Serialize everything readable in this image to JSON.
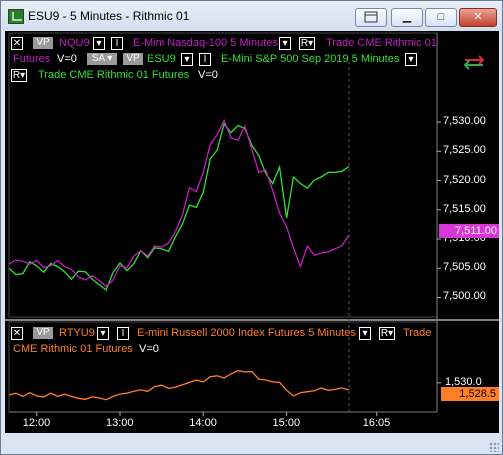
{
  "window": {
    "title": "ESU9 - 5 Minutes - Rithmic 01",
    "close_label": "✕",
    "min_label": "▁",
    "max_label": "□"
  },
  "upper_panel": {
    "legend": {
      "close_box": "✕",
      "vp": "VP",
      "sa": "SA",
      "nq_symbol": "NQU9",
      "nq_desc": "E-Mini Nasdaq-100  5 Minutes",
      "nq_type": "Trade  CME  Rithmic 01",
      "nq_futures": "Futures",
      "nq_volume": "V=0",
      "es_symbol": "ESU9",
      "es_desc": "E-Mini S&P 500 Sep 2019  5 Minutes",
      "es_type": "Trade  CME  Rithmic 01  Futures",
      "es_volume": "V=0",
      "btn_i": "I",
      "btn_r": "R"
    },
    "price_axis": [
      "7,530.00",
      "7,525.00",
      "7,520.00",
      "7,515.00",
      "7,510.00",
      "7,505.00",
      "7,500.00"
    ],
    "nq_price_label": "7,511.00",
    "colors": {
      "nq": "#c020c0",
      "es": "#33e033",
      "price_label_bg": "#d838d8"
    }
  },
  "lower_panel": {
    "legend": {
      "symbol": "RTYU9",
      "desc": "E-mini Russell 2000 Index Futures  5 Minutes",
      "trade": "Trade",
      "line2": "CME  Rithmic 01  Futures",
      "volume": "V=0"
    },
    "price_axis": [
      "1,530.0"
    ],
    "price_label": "1,528.5",
    "colors": {
      "rty": "#ff7f27",
      "price_label_bg": "#ff7f27"
    }
  },
  "time_axis": [
    "12:00",
    "13:00",
    "14:00",
    "15:00",
    "16:05"
  ],
  "chart_data": [
    {
      "type": "line",
      "title": "",
      "x": [
        "11:40",
        "11:45",
        "11:50",
        "11:55",
        "12:00",
        "12:05",
        "12:10",
        "12:15",
        "12:20",
        "12:25",
        "12:30",
        "12:35",
        "12:40",
        "12:45",
        "12:50",
        "12:55",
        "13:00",
        "13:05",
        "13:10",
        "13:15",
        "13:20",
        "13:25",
        "13:30",
        "13:35",
        "13:40",
        "13:45",
        "13:50",
        "13:55",
        "14:00",
        "14:05",
        "14:10",
        "14:15",
        "14:20",
        "14:25",
        "14:30",
        "14:35",
        "14:40",
        "14:45",
        "14:50",
        "14:55",
        "15:00",
        "15:05",
        "15:10",
        "15:15",
        "15:20",
        "15:25",
        "15:30",
        "15:35",
        "15:40",
        "15:45"
      ],
      "series": [
        {
          "name": "NQU9",
          "values": [
            7505.7,
            7506.4,
            7506.2,
            7505.7,
            7506.3,
            7505.1,
            7505.4,
            7506.3,
            7505.3,
            7504.8,
            7503.5,
            7503.0,
            7503.7,
            7502.9,
            7501.9,
            7503.0,
            7505.4,
            7505.1,
            7507.1,
            7508.0,
            7507.1,
            7508.8,
            7508.6,
            7509.3,
            7511.3,
            7514.1,
            7518.8,
            7518.1,
            7521.4,
            7526.2,
            7527.8,
            7530.3,
            7527.3,
            7526.9,
            7529.3,
            7525.3,
            7521.4,
            7521.8,
            7518.3,
            7514.4,
            7512.1,
            7508.5,
            7505.3,
            7508.8,
            7507.2,
            7507.6,
            7507.8,
            7508.3,
            7508.9,
            7510.7
          ]
        },
        {
          "name": "ESU9",
          "values": [
            7505.0,
            7503.9,
            7504.1,
            7506.1,
            7505.4,
            7504.3,
            7505.8,
            7505.3,
            7504.4,
            7503.1,
            7504.5,
            7504.4,
            7503.1,
            7502.2,
            7501.3,
            7504.3,
            7505.9,
            7504.6,
            7505.8,
            7508.0,
            7506.8,
            7508.5,
            7508.3,
            7507.9,
            7510.4,
            7512.6,
            7515.8,
            7515.4,
            7518.0,
            7523.7,
            7525.2,
            7529.7,
            7528.2,
            7529.4,
            7528.9,
            7526.0,
            7524.3,
            7521.2,
            7519.5,
            7522.3,
            7513.6,
            7520.6,
            7519.5,
            7518.7,
            7520.1,
            7520.6,
            7521.4,
            7521.4,
            7521.6,
            7522.4
          ]
        }
      ],
      "ylim": [
        7497.0,
        7536.0
      ],
      "xlabel": "",
      "ylabel": ""
    },
    {
      "type": "line",
      "title": "",
      "x": [
        "11:40",
        "11:45",
        "11:50",
        "11:55",
        "12:00",
        "12:05",
        "12:10",
        "12:15",
        "12:20",
        "12:25",
        "12:30",
        "12:35",
        "12:40",
        "12:45",
        "12:50",
        "12:55",
        "13:00",
        "13:05",
        "13:10",
        "13:15",
        "13:20",
        "13:25",
        "13:30",
        "13:35",
        "13:40",
        "13:45",
        "13:50",
        "13:55",
        "14:00",
        "14:05",
        "14:10",
        "14:15",
        "14:20",
        "14:25",
        "14:30",
        "14:35",
        "14:40",
        "14:45",
        "14:50",
        "14:55",
        "15:00",
        "15:05",
        "15:10",
        "15:15",
        "15:20",
        "15:25",
        "15:30",
        "15:35",
        "15:40",
        "15:45"
      ],
      "series": [
        {
          "name": "RTYU9",
          "values": [
            1527.4,
            1527.8,
            1527.1,
            1527.9,
            1527.2,
            1527.0,
            1527.8,
            1527.1,
            1527.6,
            1527.1,
            1526.7,
            1526.5,
            1527.0,
            1526.8,
            1526.4,
            1527.1,
            1527.6,
            1527.8,
            1528.2,
            1528.5,
            1528.2,
            1529.2,
            1529.5,
            1528.8,
            1529.1,
            1529.6,
            1530.1,
            1530.6,
            1530.2,
            1531.3,
            1531.5,
            1531.0,
            1531.9,
            1532.6,
            1532.3,
            1532.4,
            1530.8,
            1530.6,
            1530.2,
            1530.1,
            1528.4,
            1527.2,
            1527.9,
            1528.1,
            1528.3,
            1528.9,
            1528.4,
            1528.6,
            1528.9,
            1528.5
          ]
        }
      ],
      "ylim": [
        1524.0,
        1535.5
      ],
      "xlabel": "",
      "ylabel": ""
    }
  ]
}
